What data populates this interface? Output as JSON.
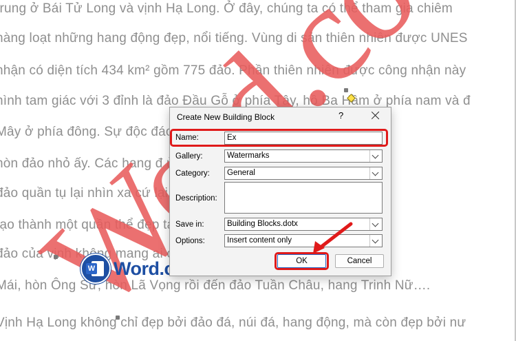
{
  "document": {
    "lines": [
      "trung ở Bái Tử Long và vịnh Hạ Long. Ở đây, chúng ta có thể tham gia chiêm",
      "hàng loạt những hang động đẹp, nổi tiếng. Vùng di sản thiên nhiên được UNES",
      "nhận có diện tích 434 km² gồm 775 đảo. Phần thiên nhiên được công nhận này",
      "hình tam giác với 3 đỉnh là đảo Đầu Gỗ ở phía Tây, hồ Ba Hầm ở phía nam và đ",
      "Mây ở phía đông. Sự độc đáo                                          dáng, đặc điểm củ",
      "hòn đảo nhỏ ấy. Các hang đ                                           ủa Hạ Long. Từng đ",
      "đảo quần tụ lại nhìn xa cứ                                          lại gần thì như xen",
      "tạo thành một quần thể đẹp                                         ta được tạo hóa ưu",
      "đảo của vịnh không mang                                             ai của vạn vật. Từ hơ",
      "Mái, hòn Ông Sư, hòn Lã Vọng rồi đến đảo Tuần Châu, hang Trinh Nữ….",
      "Vịnh Hạ Long không chỉ đẹp bởi đảo đá, núi đá, hang động, mà còn đẹp bởi nư"
    ],
    "watermark_text": "Word.co"
  },
  "logo": {
    "badge_letter": "W",
    "text": "Word.com.vn"
  },
  "dialog": {
    "title": "Create New Building Block",
    "help": "?",
    "name_label": "Name:",
    "name_value": "Ex",
    "gallery_label": "Gallery:",
    "gallery_value": "Watermarks",
    "category_label": "Category:",
    "category_value": "General",
    "description_label": "Description:",
    "description_value": "",
    "save_in_label": "Save in:",
    "save_in_value": "Building Blocks.dotx",
    "options_label": "Options:",
    "options_value": "Insert content only",
    "ok_label": "OK",
    "cancel_label": "Cancel"
  },
  "colors": {
    "highlight": "#e01a1a",
    "watermark": "#e85c5c",
    "logo_blue": "#1e4fa3"
  }
}
